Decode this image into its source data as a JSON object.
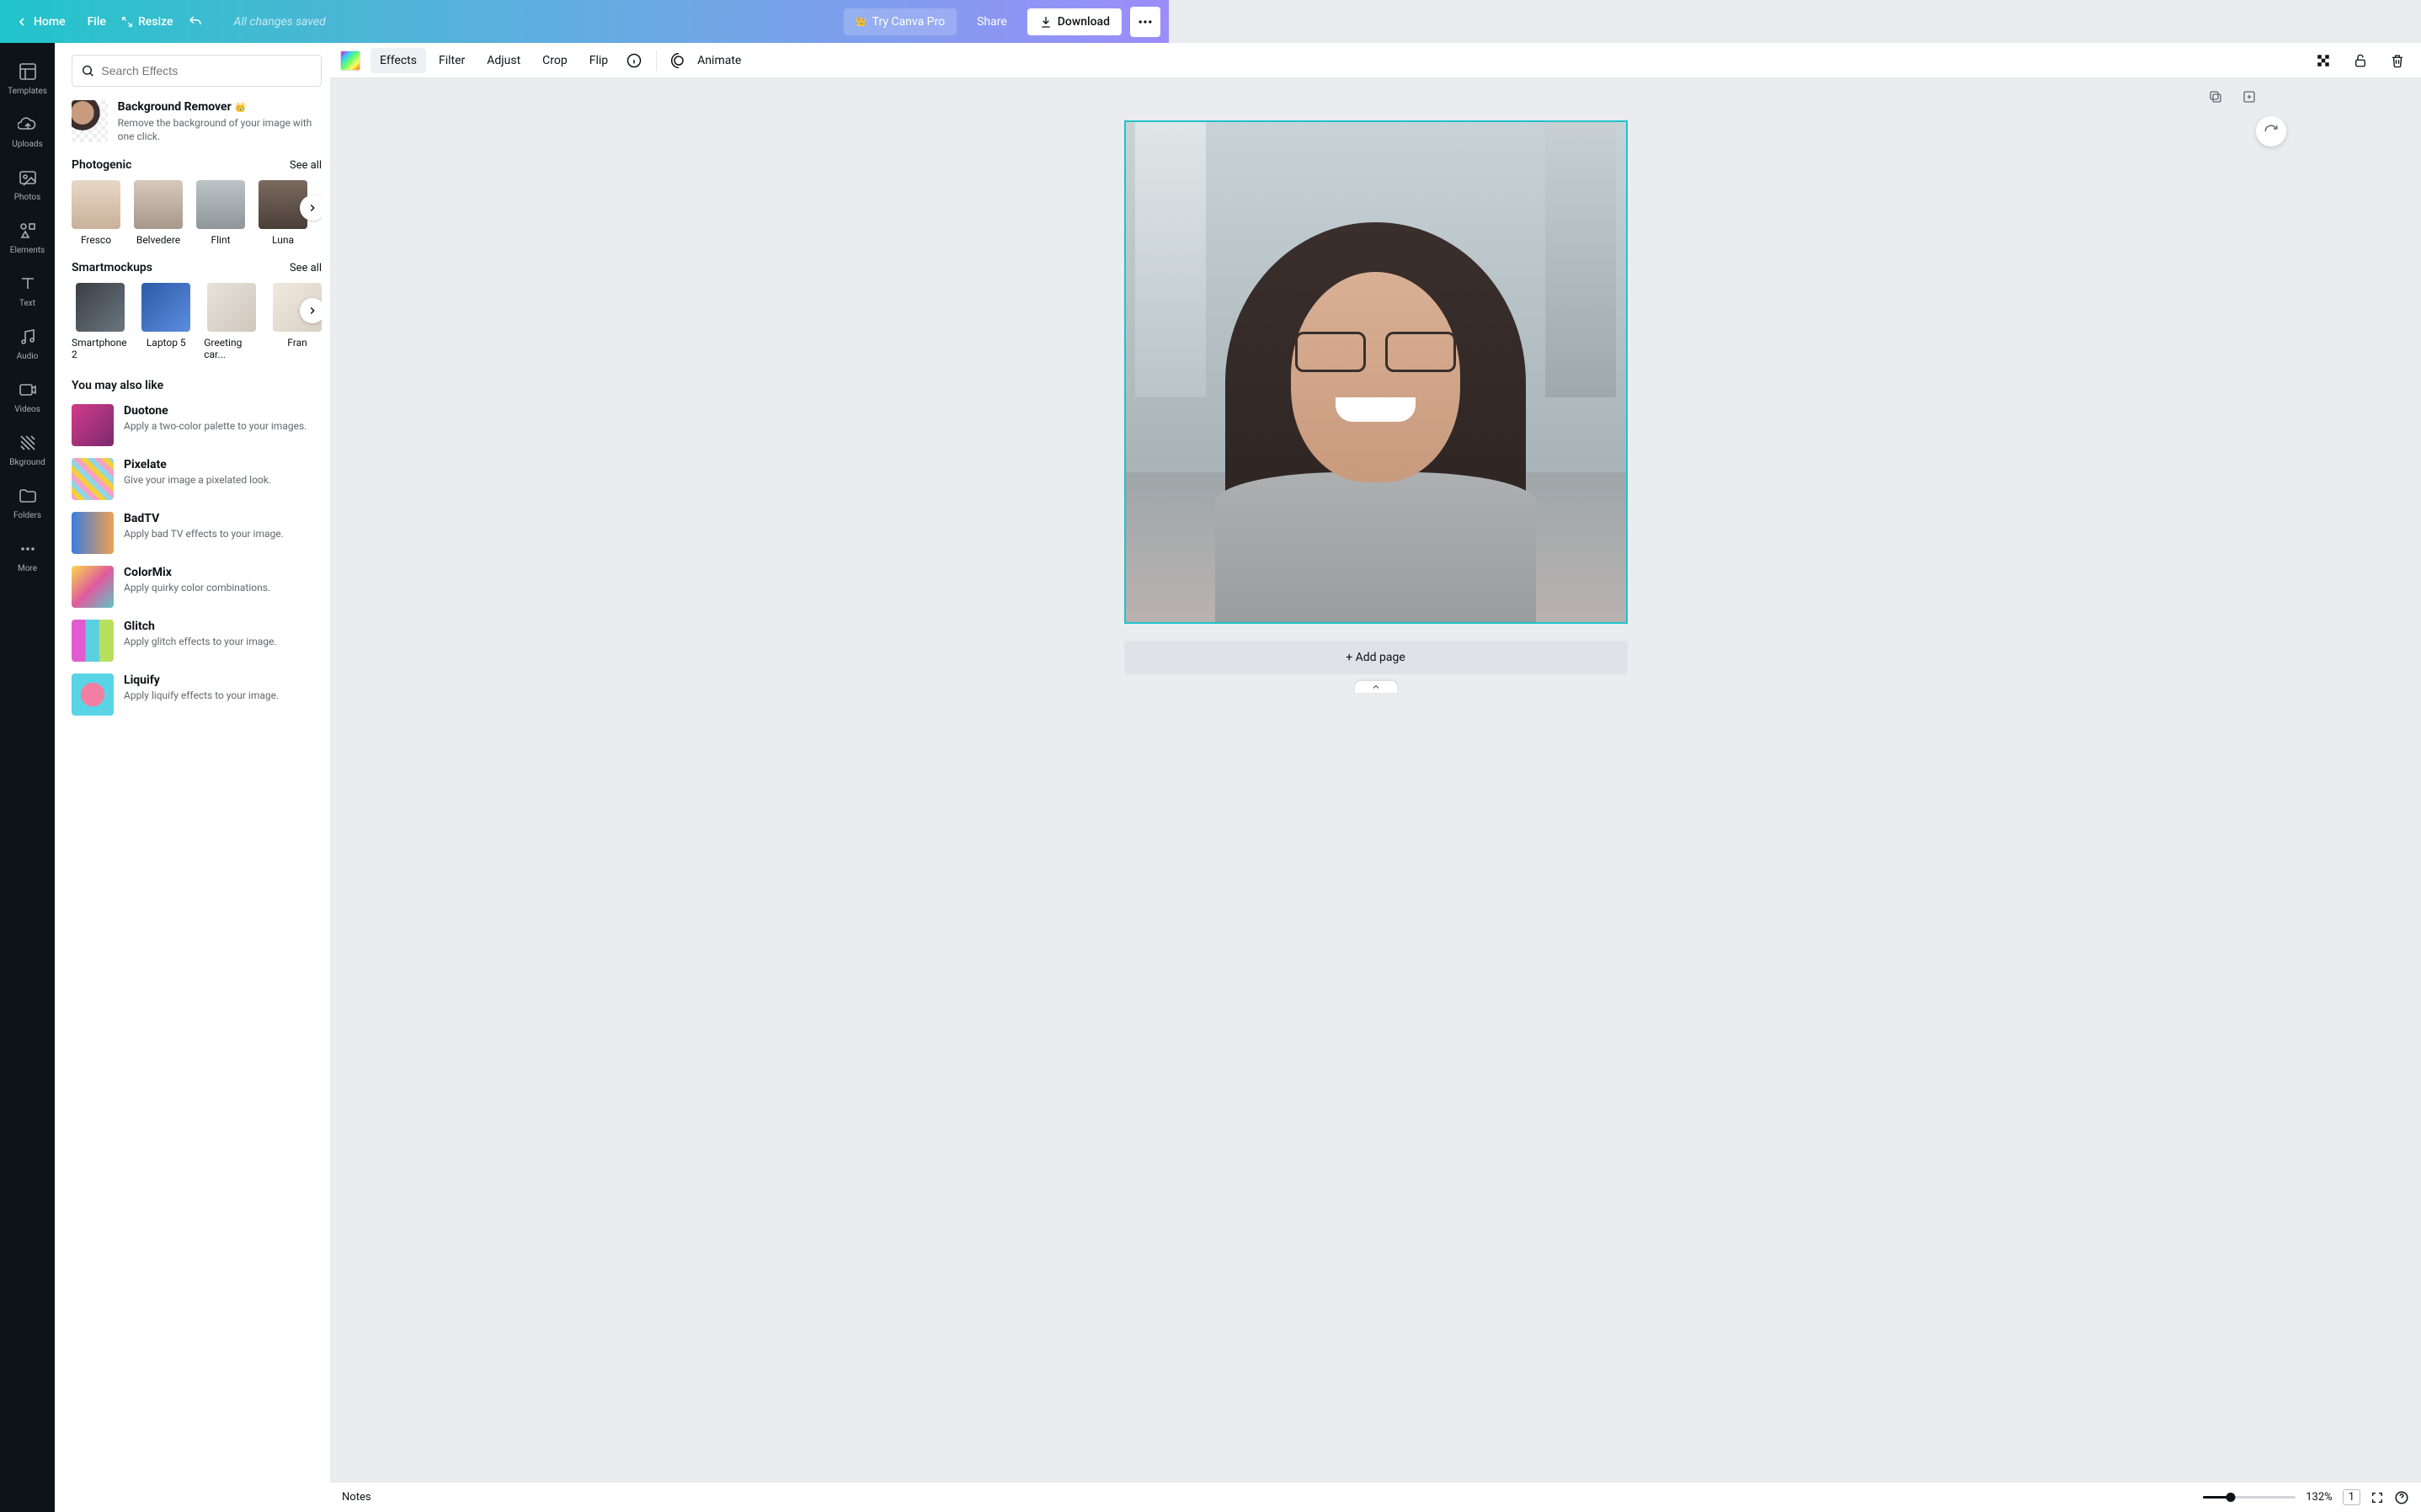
{
  "header": {
    "home": "Home",
    "file": "File",
    "resize": "Resize",
    "saved": "All changes saved",
    "try_pro": "Try Canva Pro",
    "share": "Share",
    "download": "Download"
  },
  "nav": {
    "templates": "Templates",
    "uploads": "Uploads",
    "photos": "Photos",
    "elements": "Elements",
    "text": "Text",
    "audio": "Audio",
    "videos": "Videos",
    "bkground": "Bkground",
    "folders": "Folders",
    "more": "More"
  },
  "panel": {
    "search_placeholder": "Search Effects",
    "bg_remover_title": "Background Remover",
    "bg_remover_desc": "Remove the background of your image with one click.",
    "photogenic_title": "Photogenic",
    "smartmockups_title": "Smartmockups",
    "you_may_like_title": "You may also like",
    "see_all": "See all",
    "photogenic": {
      "items": [
        {
          "label": "Fresco"
        },
        {
          "label": "Belvedere"
        },
        {
          "label": "Flint"
        },
        {
          "label": "Luna"
        }
      ]
    },
    "smartmockups": {
      "items": [
        {
          "label": "Smartphone 2"
        },
        {
          "label": "Laptop 5"
        },
        {
          "label": "Greeting car..."
        },
        {
          "label": "Fran"
        }
      ]
    },
    "recommended": {
      "items": [
        {
          "title": "Duotone",
          "desc": "Apply a two-color palette to your images."
        },
        {
          "title": "Pixelate",
          "desc": "Give your image a pixelated look."
        },
        {
          "title": "BadTV",
          "desc": "Apply bad TV effects to your image."
        },
        {
          "title": "ColorMix",
          "desc": "Apply quirky color combinations."
        },
        {
          "title": "Glitch",
          "desc": "Apply glitch effects to your image."
        },
        {
          "title": "Liquify",
          "desc": "Apply liquify effects to your image."
        }
      ]
    }
  },
  "context": {
    "effects": "Effects",
    "filter": "Filter",
    "adjust": "Adjust",
    "crop": "Crop",
    "flip": "Flip",
    "animate": "Animate"
  },
  "canvas": {
    "add_page": "+ Add page"
  },
  "footer": {
    "notes": "Notes",
    "zoom": "132%",
    "page": "1"
  }
}
